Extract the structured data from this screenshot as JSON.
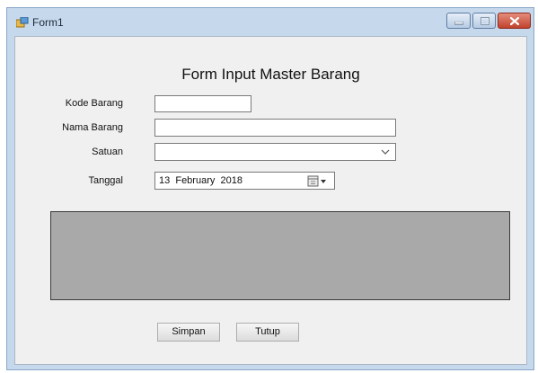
{
  "window": {
    "title": "Form1"
  },
  "form": {
    "heading": "Form Input Master Barang",
    "kode_barang": {
      "label": "Kode Barang",
      "value": ""
    },
    "nama_barang": {
      "label": "Nama Barang",
      "value": ""
    },
    "satuan": {
      "label": "Satuan",
      "selected": ""
    },
    "tanggal": {
      "label": "Tanggal",
      "value": "13  February  2018"
    }
  },
  "buttons": {
    "simpan": "Simpan",
    "tutup": "Tutup"
  },
  "icons": {
    "app": "form-app-icon",
    "minimize": "minimize-icon",
    "maximize": "maximize-icon",
    "close": "close-icon",
    "dropdown": "chevron-down-icon",
    "calendar": "calendar-icon"
  },
  "colors": {
    "window_frame": "#c6d8ec",
    "client_bg": "#f0f0f0",
    "panel_bg": "#a9a9a9",
    "close_button": "#c1432d"
  }
}
